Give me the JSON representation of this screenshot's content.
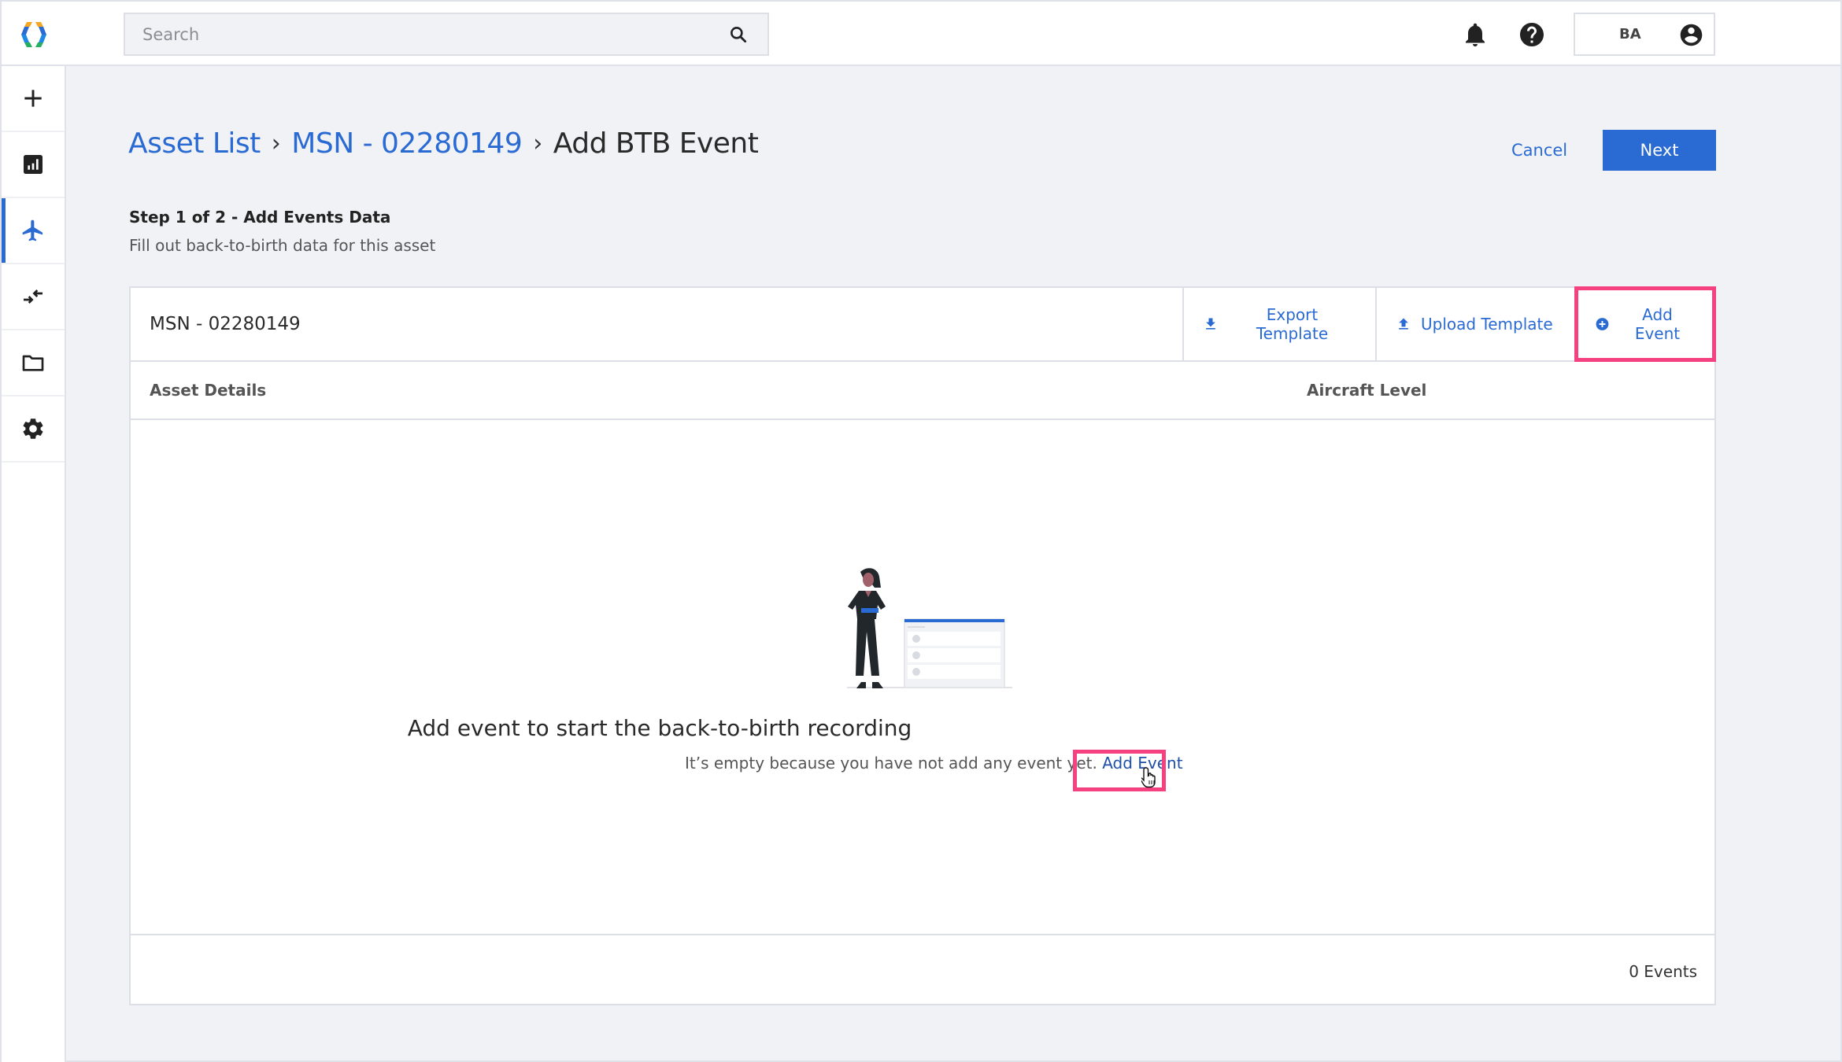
{
  "app": {
    "accent_color": "#2a6ad3",
    "highlight_color": "#f5417f"
  },
  "topbar": {
    "search": {
      "placeholder": "Search",
      "value": ""
    },
    "icons": [
      "logo-icon",
      "search-icon",
      "bell-icon",
      "help-icon",
      "account-icon"
    ],
    "user_initials": "BA"
  },
  "sidebar": {
    "items": [
      {
        "name": "create",
        "icon": "plus-icon",
        "active": false
      },
      {
        "name": "dashboard",
        "icon": "chart-icon",
        "active": false
      },
      {
        "name": "assets",
        "icon": "airplane-icon",
        "active": true
      },
      {
        "name": "transfers",
        "icon": "swap-arrows-icon",
        "active": false
      },
      {
        "name": "documents",
        "icon": "folder-icon",
        "active": false
      },
      {
        "name": "settings",
        "icon": "gear-icon",
        "active": false
      }
    ]
  },
  "header": {
    "breadcrumb": [
      {
        "label": "Asset List",
        "link": true
      },
      {
        "label": "MSN - 02280149",
        "link": true
      },
      {
        "label": "Add BTB Event",
        "link": false
      }
    ],
    "separator": "›",
    "cancel_label": "Cancel",
    "next_label": "Next"
  },
  "step": {
    "title": "Step 1 of 2 - Add Events Data",
    "subtitle": "Fill out back-to-birth data for this asset"
  },
  "card": {
    "title": "MSN - 02280149",
    "toolbar": {
      "export_label": "Export Template",
      "upload_label": "Upload Template",
      "add_label": "Add Event"
    },
    "columns": [
      "Asset Details",
      "Aircraft Level"
    ],
    "empty_state": {
      "title": "Add event to start the back-to-birth recording",
      "text": "It’s empty because you have not add any event yet.",
      "link_label": "Add Event"
    },
    "footer": {
      "event_count": "0 Events"
    }
  }
}
